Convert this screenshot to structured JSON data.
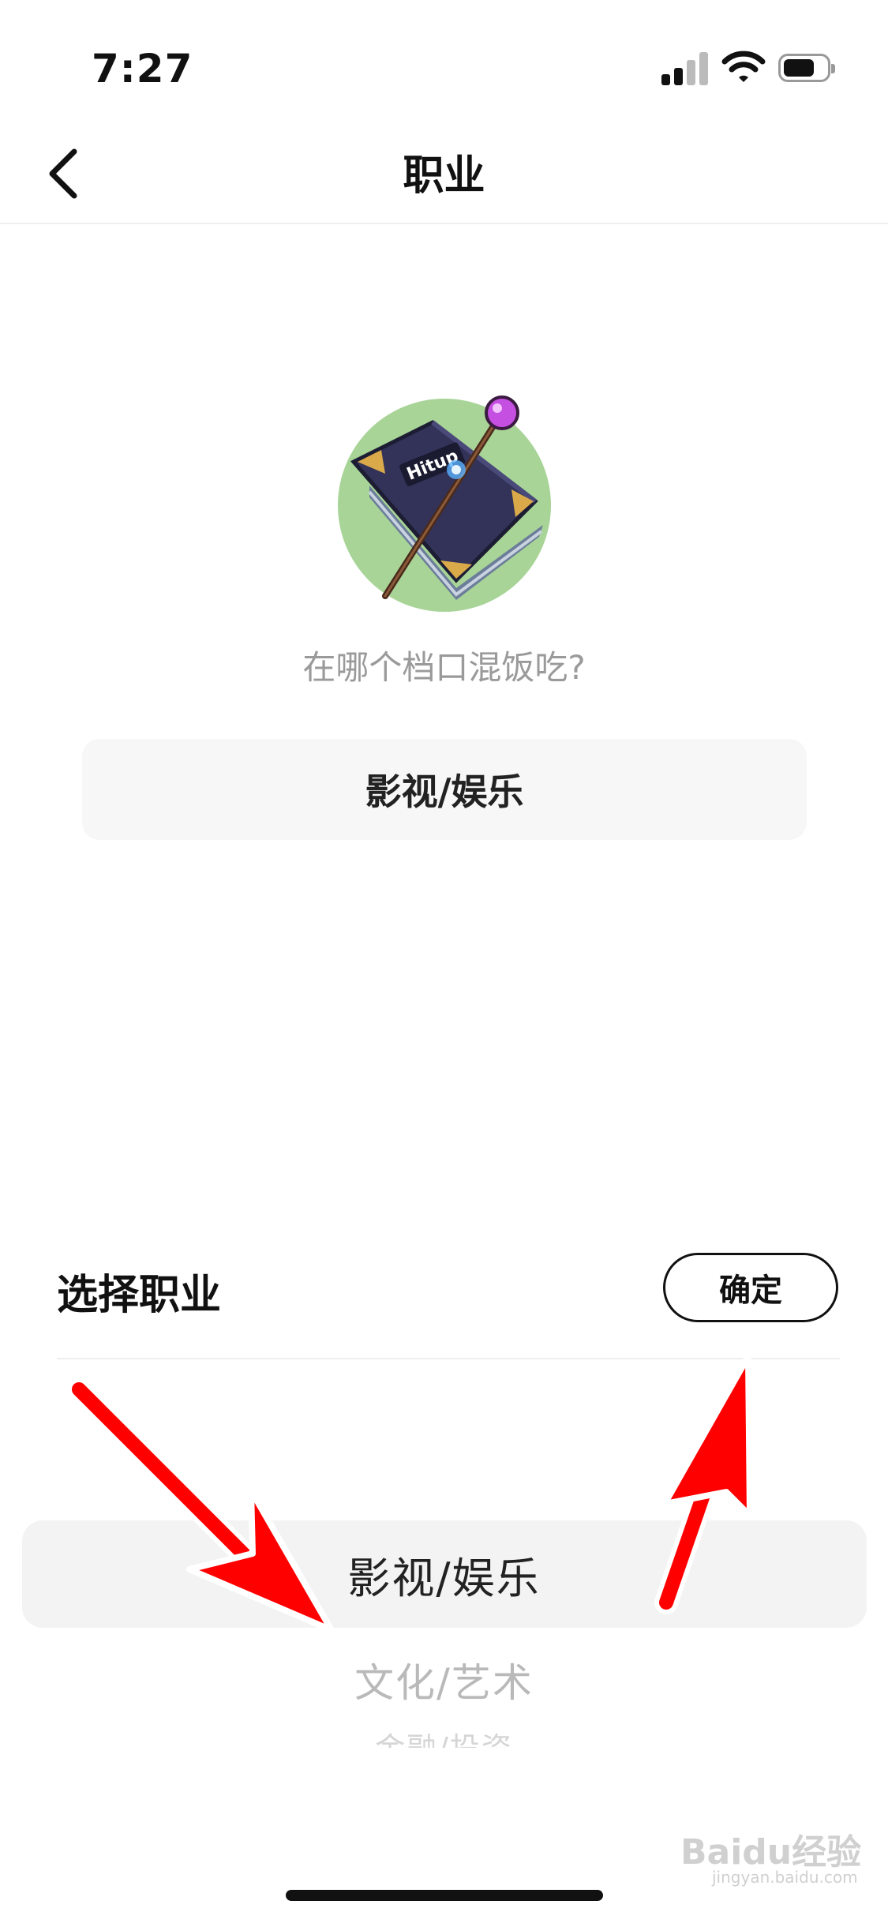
{
  "status_bar": {
    "time": "7:27"
  },
  "nav": {
    "title": "职业",
    "back_icon": "chevron-left-icon"
  },
  "avatar": {
    "badge_text": "Hitup"
  },
  "prompt": "在哪个档口混饭吃?",
  "current_selection": "影视/娱乐",
  "picker": {
    "title": "选择职业",
    "confirm_label": "确定",
    "options": [
      "影视/娱乐",
      "文化/艺术",
      "金融/投资"
    ],
    "selected_index": 0
  },
  "watermark": {
    "brand": "Baidu经验",
    "sub": "jingyan.baidu.com"
  },
  "colors": {
    "avatar_bg": "#a8d497",
    "arrow": "#ff0000",
    "highlight": "#f3f3f3"
  }
}
